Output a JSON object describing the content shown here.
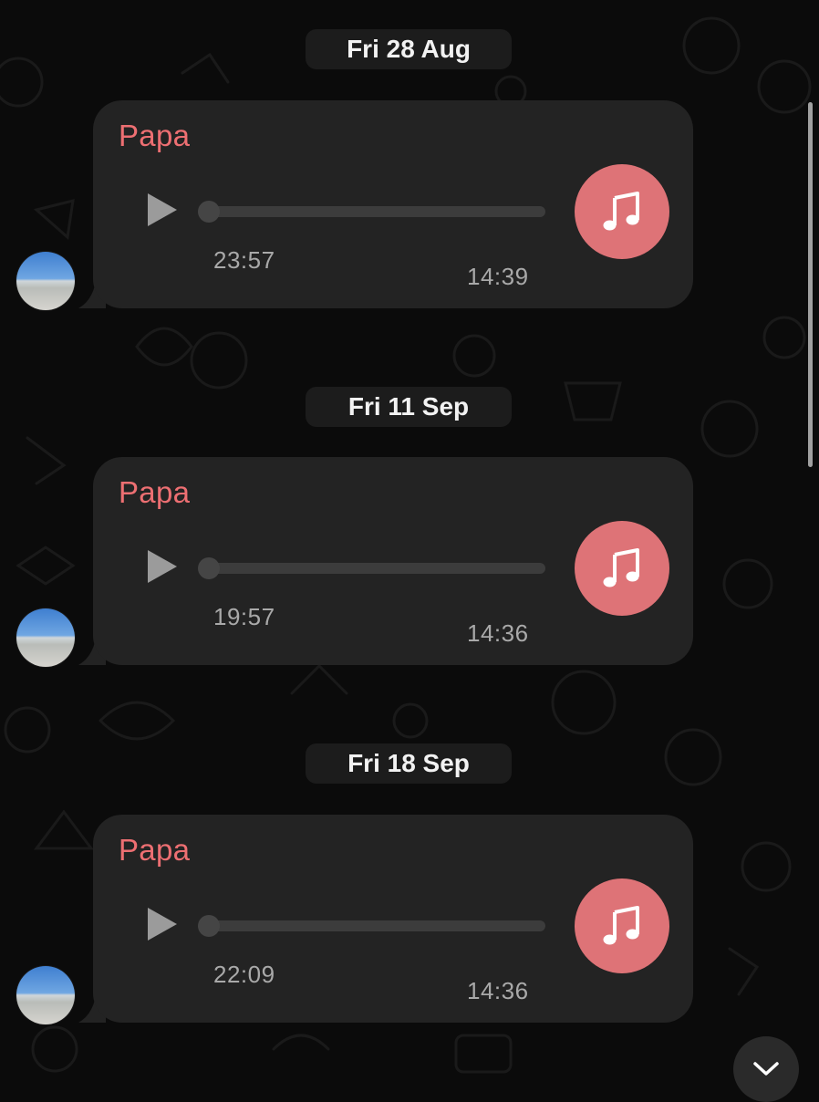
{
  "conversation": {
    "accent_color": "#ed6f72",
    "music_button_color": "#de7377",
    "messages": [
      {
        "date": "Fri 28 Aug",
        "sender": "Papa",
        "duration": "23:57",
        "time": "14:39"
      },
      {
        "date": "Fri 11 Sep",
        "sender": "Papa",
        "duration": "19:57",
        "time": "14:36"
      },
      {
        "date": "Fri 18 Sep",
        "sender": "Papa",
        "duration": "22:09",
        "time": "14:36"
      }
    ]
  },
  "icons": {
    "play": "play-icon",
    "music": "music-note-icon",
    "scroll_down": "chevron-down-icon"
  }
}
